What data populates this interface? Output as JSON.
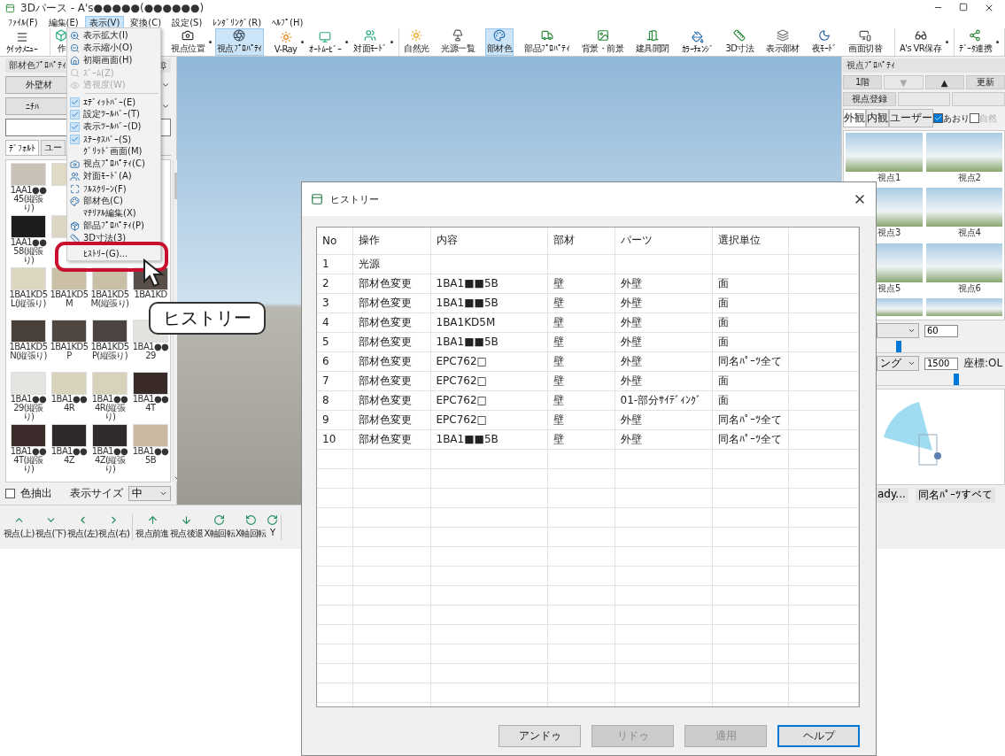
{
  "window": {
    "title": "3Dパース - A's●●●●●(●●●●●●)"
  },
  "menu_bar": [
    {
      "label": "ﾌｧｲﾙ(F)",
      "selected": false
    },
    {
      "label": "編集(E)",
      "selected": false
    },
    {
      "label": "表示(V)",
      "selected": true
    },
    {
      "label": "変換(C)",
      "selected": false
    },
    {
      "label": "設定(S)",
      "selected": false
    },
    {
      "label": "ﾚﾝﾀﾞﾘﾝｸﾞ(R)",
      "selected": false
    },
    {
      "label": "ﾍﾙﾌﾟ(H)",
      "selected": false
    }
  ],
  "toolbar": [
    {
      "items": [
        {
          "label": "ｸｲｯｸﾒﾆｭｰ",
          "selected": false,
          "dropdown": false
        }
      ]
    },
    {
      "items": [
        {
          "label": "作",
          "selected": false
        }
      ]
    },
    {
      "items": [
        {
          "label": "視点位置",
          "selected": false,
          "dropdown": true
        },
        {
          "label": "視点ﾌﾟﾛﾊﾟﾃｨ",
          "selected": true,
          "dropdown": false
        },
        {
          "label": "V-Ray",
          "selected": false,
          "dropdown": true
        },
        {
          "label": "ｵｰﾄﾑｰﾋﾞｰ",
          "selected": false,
          "dropdown": true
        },
        {
          "label": "対面ﾓｰﾄﾞ",
          "selected": false,
          "dropdown": true
        }
      ]
    },
    {
      "items": [
        {
          "label": "自然光",
          "selected": false,
          "dropdown": false
        },
        {
          "label": "光源一覧",
          "selected": false,
          "dropdown": false
        },
        {
          "label": "部材色",
          "selected": true,
          "dropdown": false
        },
        {
          "label": "部品ﾌﾟﾛﾊﾟﾃｨ",
          "selected": false,
          "dropdown": false
        },
        {
          "label": "背景・前景",
          "selected": false,
          "dropdown": false
        },
        {
          "label": "建具開閉",
          "selected": false,
          "dropdown": false
        },
        {
          "label": "ｶﾗｰﾁｪﾝｼﾞ",
          "selected": false,
          "dropdown": false
        },
        {
          "label": "3D寸法",
          "selected": false,
          "dropdown": false
        },
        {
          "label": "表示部材",
          "selected": false,
          "dropdown": false
        },
        {
          "label": "夜ﾓｰﾄﾞ",
          "selected": false,
          "dropdown": false
        },
        {
          "label": "画面切替",
          "selected": false,
          "dropdown": false
        }
      ]
    },
    {
      "items": [
        {
          "label": "A's VR保存",
          "selected": false,
          "dropdown": true
        }
      ]
    },
    {
      "items": [
        {
          "label": "ﾃﾞｰﾀ連携",
          "selected": false,
          "dropdown": true
        }
      ]
    }
  ],
  "view_menu": [
    {
      "kind": "icon",
      "label": "表示拡大(I)",
      "disabled": false
    },
    {
      "kind": "icon",
      "label": "表示縮小(O)",
      "disabled": false
    },
    {
      "kind": "icon",
      "label": "初期画面(H)",
      "disabled": false
    },
    {
      "kind": "icon",
      "label": "ｽﾞｰﾑ(Z)",
      "disabled": true
    },
    {
      "kind": "icon",
      "label": "透視度(W)",
      "disabled": true
    },
    {
      "kind": "separator"
    },
    {
      "kind": "check",
      "label": "ｴﾃﾞｨｯﾄﾊﾞｰ(E)",
      "checked": true,
      "disabled": false
    },
    {
      "kind": "check",
      "label": "設定ﾂｰﾙﾊﾞｰ(T)",
      "checked": true,
      "disabled": false
    },
    {
      "kind": "check",
      "label": "表示ﾂｰﾙﾊﾞｰ(D)",
      "checked": true,
      "disabled": false
    },
    {
      "kind": "check",
      "label": "ｽﾃｰﾀｽﾊﾞｰ(S)",
      "checked": true,
      "disabled": false
    },
    {
      "kind": "plain",
      "label": "ｸﾞﾘｯﾄﾞ画面(M)",
      "disabled": false
    },
    {
      "kind": "icon",
      "label": "視点ﾌﾟﾛﾊﾟﾃｨ(C)",
      "disabled": false
    },
    {
      "kind": "icon",
      "label": "対面ﾓｰﾄﾞ(A)",
      "disabled": false
    },
    {
      "kind": "icon",
      "label": "ﾌﾙｽｸﾘｰﾝ(F)",
      "disabled": false
    },
    {
      "kind": "icon",
      "label": "部材色(C)",
      "disabled": false
    },
    {
      "kind": "plain",
      "label": "ﾏﾃﾘｱﾙ編集(X)",
      "disabled": false
    },
    {
      "kind": "icon",
      "label": "部品ﾌﾟﾛﾊﾟﾃｨ(P)",
      "disabled": false
    },
    {
      "kind": "icon",
      "label": "3D寸法(3)",
      "disabled": false
    },
    {
      "kind": "gap"
    },
    {
      "kind": "plain",
      "label": "ﾋｽﾄﾘｰ(G)...",
      "disabled": false,
      "circled": true
    }
  ],
  "callout": "ヒストリー",
  "material_panel": {
    "title": "部材色ﾌﾟﾛﾊﾟﾃｨ",
    "category": "外壁材",
    "maker": "ﾆﾁﾊ",
    "tabs": [
      {
        "label": "ﾃﾞﾌｫﾙﾄ",
        "selected": true
      },
      {
        "label": "ユー",
        "selected": false
      }
    ],
    "swatches": [
      {
        "kind": "swatch",
        "label": "1AA1●●45(縦張り)",
        "color": "#c8c2b6"
      },
      {
        "kind": "swatch",
        "color": "#e0d9c6"
      },
      {
        "kind": "covered"
      },
      {
        "kind": "covered"
      },
      {
        "kind": "swatch",
        "label": "1AA1●●58(縦張り)",
        "color": "#1e1c1e"
      },
      {
        "kind": "swatch",
        "color": "#ddd6c4"
      },
      {
        "kind": "covered"
      },
      {
        "kind": "covered"
      },
      {
        "kind": "swatch",
        "label": "1BA1KD5L(縦張り)",
        "color": "#dcd6c0"
      },
      {
        "kind": "swatch",
        "label": "1BA1KD5M",
        "color": "#cbbfa5"
      },
      {
        "kind": "swatch",
        "label": "1BA1KD5M(縦張り)",
        "color": "#c8bfa6"
      },
      {
        "kind": "swatch",
        "label": "1BA1KD",
        "color": "#5a4f48"
      },
      {
        "kind": "swatch",
        "label": "1BA1KD5N(縦張り)",
        "color": "#4a403a"
      },
      {
        "kind": "swatch",
        "label": "1BA1KD5P",
        "color": "#4f4740"
      },
      {
        "kind": "swatch",
        "label": "1BA1KD5P(縦張り)",
        "color": "#4c4440"
      },
      {
        "kind": "swatch",
        "label": "1BA1●●29",
        "color": "#e4e2de"
      },
      {
        "kind": "swatch",
        "label": "1BA1●●29(縦張り)",
        "color": "#e6e4e0"
      },
      {
        "kind": "swatch",
        "label": "1BA1●●4R",
        "color": "#d9d3bc"
      },
      {
        "kind": "swatch",
        "label": "1BA1●●4R(縦張り)",
        "color": "#d6d2bb"
      },
      {
        "kind": "swatch",
        "label": "1BA1●●4T",
        "color": "#3a2a28"
      },
      {
        "kind": "swatch",
        "label": "1BA1●●4T(縦張り)",
        "color": "#3b2b2a"
      },
      {
        "kind": "swatch",
        "label": "1BA1●●4Z",
        "color": "#2e2a2c"
      },
      {
        "kind": "swatch",
        "label": "1BA1●●4Z(縦張り)",
        "color": "#302b2c"
      },
      {
        "kind": "swatch",
        "label": "1BA1●●5B",
        "color": "#c9b9a3"
      }
    ],
    "color_pick": {
      "label": "色抽出",
      "checked": false
    },
    "size": {
      "label": "表示サイズ",
      "value": "中"
    }
  },
  "view_toolbar": [
    {
      "items": [
        {
          "label": "視点(上)"
        },
        {
          "label": "視点(下)"
        },
        {
          "label": "視点(左)"
        },
        {
          "label": "視点(右)"
        }
      ]
    },
    {
      "items": [
        {
          "label": "視点前進"
        },
        {
          "label": "視点後退"
        },
        {
          "label": "X軸回転"
        },
        {
          "label": "X軸回転"
        },
        {
          "label": "Y"
        }
      ]
    }
  ],
  "view_panel": {
    "title": "視点ﾌﾟﾛﾊﾟﾃｨ",
    "floor_buttons": [
      {
        "label": "1階",
        "disabled": false
      },
      {
        "label": "▼",
        "disabled": true
      },
      {
        "label": "▲",
        "disabled": false
      },
      {
        "label": "更新",
        "disabled": false
      }
    ],
    "register_buttons": [
      {
        "label": "視点登録",
        "disabled": false
      },
      {
        "disabled": true
      },
      {
        "disabled": true
      }
    ],
    "tabs": [
      {
        "label": "外観",
        "selected": true
      },
      {
        "label": "内観",
        "selected": false
      },
      {
        "label": "ユーザー",
        "selected": false
      }
    ],
    "tilt": {
      "label": "あおり",
      "checked": true
    },
    "natural_light": {
      "label": "自然",
      "checked": false
    },
    "thumbnails": [
      {
        "kind": "full",
        "label": "視点1"
      },
      {
        "kind": "full",
        "label": "視点2"
      },
      {
        "kind": "full",
        "label": "視点3"
      },
      {
        "kind": "full",
        "label": "視点4"
      },
      {
        "kind": "full",
        "label": "視点5"
      },
      {
        "kind": "full",
        "label": "視点6"
      },
      {
        "kind": "partial"
      },
      {
        "kind": "partial"
      }
    ],
    "angle": {
      "value": "60",
      "level": 0.15
    },
    "mode": {
      "value": "ング",
      "distance": "1500",
      "unit": "座標:OL",
      "level": 0.6
    },
    "status": [
      "ady...",
      "同名ﾊﾟｰﾂすべて"
    ]
  },
  "history": {
    "title": "ヒストリー",
    "columns": [
      "No",
      "操作",
      "内容",
      "部材",
      "パーツ",
      "選択単位"
    ],
    "rows": [
      [
        "1",
        "光源"
      ],
      [
        "2",
        "部材色変更",
        "1BA1■■5B",
        "壁",
        "外壁",
        "面"
      ],
      [
        "3",
        "部材色変更",
        "1BA1■■5B",
        "壁",
        "外壁",
        "面"
      ],
      [
        "4",
        "部材色変更",
        "1BA1KD5M",
        "壁",
        "外壁",
        "面"
      ],
      [
        "5",
        "部材色変更",
        "1BA1■■5B",
        "壁",
        "外壁",
        "面"
      ],
      [
        "6",
        "部材色変更",
        "EPC762□",
        "壁",
        "外壁",
        "同名ﾊﾟｰﾂ全て"
      ],
      [
        "7",
        "部材色変更",
        "EPC762□",
        "壁",
        "外壁",
        "面"
      ],
      [
        "8",
        "部材色変更",
        "EPC762□",
        "壁",
        "01-部分ｻｲﾃﾞｨﾝｸﾞ",
        "面"
      ],
      [
        "9",
        "部材色変更",
        "EPC762□",
        "壁",
        "外壁",
        "同名ﾊﾟｰﾂ全て"
      ],
      [
        "10",
        "部材色変更",
        "1BA1■■5B",
        "壁",
        "外壁",
        "同名ﾊﾟｰﾂ全て"
      ]
    ],
    "buttons": [
      {
        "label": "アンドゥ",
        "disabled": false,
        "focused": false
      },
      {
        "label": "リドゥ",
        "disabled": true,
        "focused": false
      },
      {
        "label": "適用",
        "disabled": true,
        "focused": false
      },
      {
        "label": "ヘルプ",
        "disabled": false,
        "focused": true
      }
    ]
  }
}
